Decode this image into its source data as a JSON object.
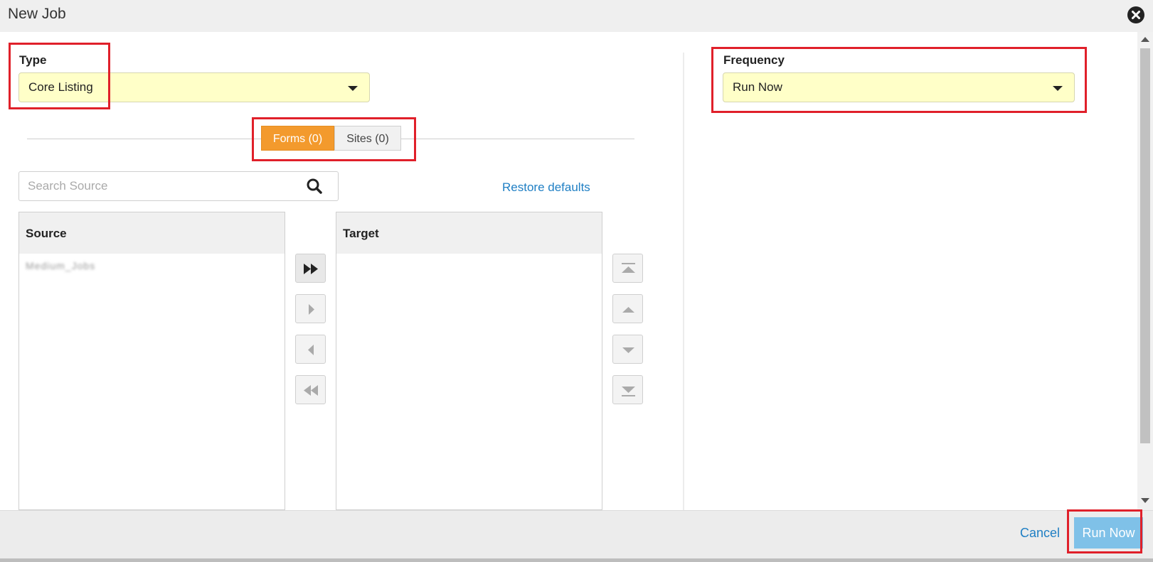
{
  "header": {
    "title": "New Job"
  },
  "type_field": {
    "label": "Type",
    "value": "Core Listing"
  },
  "frequency_field": {
    "label": "Frequency",
    "value": "Run Now"
  },
  "tabs": [
    {
      "label": "Forms (0)",
      "active": true
    },
    {
      "label": "Sites (0)",
      "active": false
    }
  ],
  "search": {
    "placeholder": "Search Source"
  },
  "restore_defaults": "Restore defaults",
  "source": {
    "header": "Source",
    "items": [
      "Medium_Jobs"
    ]
  },
  "target": {
    "header": "Target",
    "items": []
  },
  "footer": {
    "cancel": "Cancel",
    "run": "Run Now"
  },
  "colors": {
    "accent_orange": "#f39a2d",
    "select_bg": "#ffffc8",
    "link_blue": "#1f7fc4",
    "run_button": "#7fc1e8",
    "highlight": "#e0202a"
  }
}
